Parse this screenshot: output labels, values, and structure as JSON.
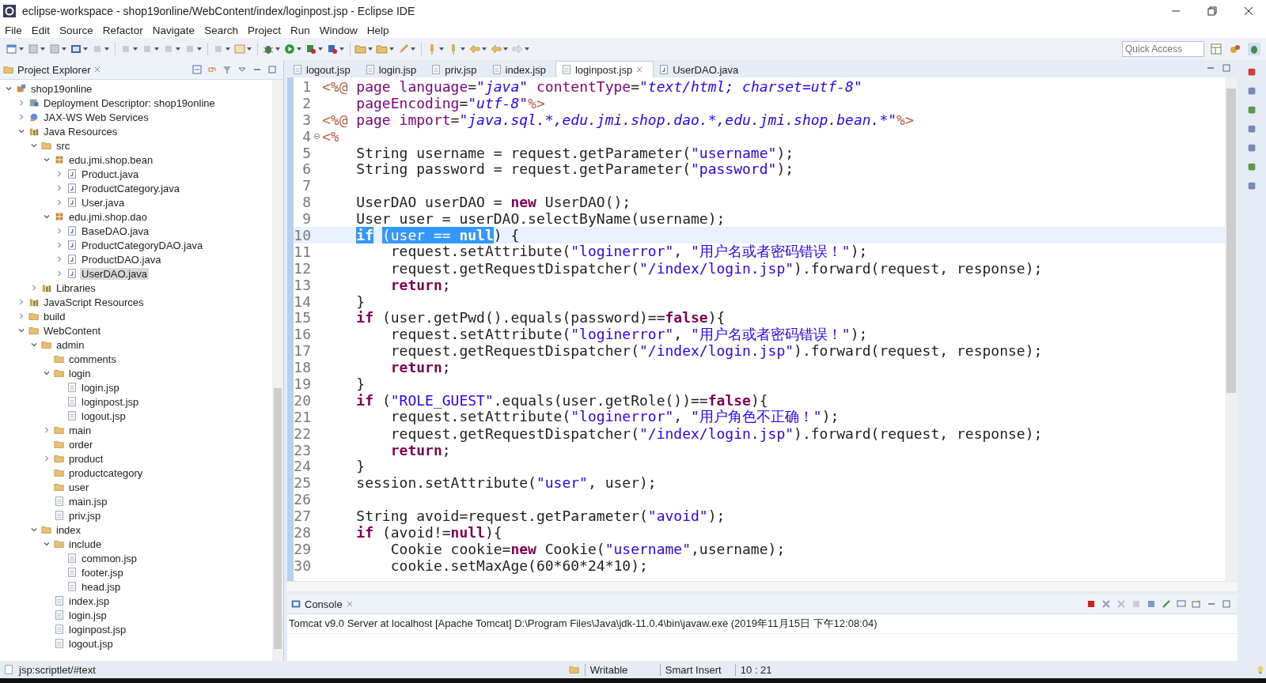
{
  "window": {
    "title": "eclipse-workspace - shop19online/WebContent/index/loginpost.jsp - Eclipse IDE"
  },
  "menu": [
    "File",
    "Edit",
    "Source",
    "Refactor",
    "Navigate",
    "Search",
    "Project",
    "Run",
    "Window",
    "Help"
  ],
  "quick_access": {
    "placeholder": "Quick Access"
  },
  "project_explorer": {
    "title": "Project Explorer",
    "tree": [
      {
        "label": "shop19online",
        "kind": "project",
        "expanded": true,
        "selected": false,
        "children": [
          {
            "label": "Deployment Descriptor: shop19online",
            "kind": "descriptor",
            "expanded": false,
            "selected": false
          },
          {
            "label": "JAX-WS Web Services",
            "kind": "services",
            "expanded": false,
            "selected": false
          },
          {
            "label": "Java Resources",
            "kind": "javares",
            "expanded": true,
            "selected": false,
            "children": [
              {
                "label": "src",
                "kind": "srcfolder",
                "expanded": true,
                "selected": false,
                "children": [
                  {
                    "label": "edu.jmi.shop.bean",
                    "kind": "package",
                    "expanded": true,
                    "selected": false,
                    "children": [
                      {
                        "label": "Product.java",
                        "kind": "java",
                        "expanded": false,
                        "selected": false
                      },
                      {
                        "label": "ProductCategory.java",
                        "kind": "java",
                        "expanded": false,
                        "selected": false
                      },
                      {
                        "label": "User.java",
                        "kind": "java",
                        "expanded": false,
                        "selected": false
                      }
                    ]
                  },
                  {
                    "label": "edu.jmi.shop.dao",
                    "kind": "package",
                    "expanded": true,
                    "selected": false,
                    "children": [
                      {
                        "label": "BaseDAO.java",
                        "kind": "java",
                        "expanded": false,
                        "selected": false
                      },
                      {
                        "label": "ProductCategoryDAO.java",
                        "kind": "java",
                        "expanded": false,
                        "selected": false
                      },
                      {
                        "label": "ProductDAO.java",
                        "kind": "java",
                        "expanded": false,
                        "selected": false
                      },
                      {
                        "label": "UserDAO.java",
                        "kind": "java",
                        "expanded": false,
                        "selected": true
                      }
                    ]
                  }
                ]
              },
              {
                "label": "Libraries",
                "kind": "library",
                "expanded": false,
                "selected": false
              }
            ]
          },
          {
            "label": "JavaScript Resources",
            "kind": "library",
            "expanded": false,
            "selected": false
          },
          {
            "label": "build",
            "kind": "folder",
            "expanded": false,
            "selected": false
          },
          {
            "label": "WebContent",
            "kind": "folder",
            "expanded": true,
            "selected": false,
            "children": [
              {
                "label": "admin",
                "kind": "folder",
                "expanded": true,
                "selected": false,
                "children": [
                  {
                    "label": "comments",
                    "kind": "folder",
                    "selected": false
                  },
                  {
                    "label": "login",
                    "kind": "folder",
                    "expanded": true,
                    "selected": false,
                    "children": [
                      {
                        "label": "login.jsp",
                        "kind": "jsp",
                        "selected": false
                      },
                      {
                        "label": "loginpost.jsp",
                        "kind": "jsp",
                        "selected": false
                      },
                      {
                        "label": "logout.jsp",
                        "kind": "jsp",
                        "selected": false
                      }
                    ]
                  },
                  {
                    "label": "main",
                    "kind": "folder",
                    "expanded": false,
                    "selected": false
                  },
                  {
                    "label": "order",
                    "kind": "folder",
                    "selected": false
                  },
                  {
                    "label": "product",
                    "kind": "folder",
                    "expanded": false,
                    "selected": false
                  },
                  {
                    "label": "productcategory",
                    "kind": "folder",
                    "selected": false
                  },
                  {
                    "label": "user",
                    "kind": "folder",
                    "selected": false
                  },
                  {
                    "label": "main.jsp",
                    "kind": "jsp",
                    "selected": false
                  },
                  {
                    "label": "priv.jsp",
                    "kind": "jsp",
                    "selected": false
                  }
                ]
              },
              {
                "label": "index",
                "kind": "folder",
                "expanded": true,
                "selected": false,
                "children": [
                  {
                    "label": "include",
                    "kind": "folder",
                    "expanded": true,
                    "selected": false,
                    "children": [
                      {
                        "label": "common.jsp",
                        "kind": "jsp",
                        "selected": false
                      },
                      {
                        "label": "footer.jsp",
                        "kind": "jsp",
                        "selected": false
                      },
                      {
                        "label": "head.jsp",
                        "kind": "jsp",
                        "selected": false
                      }
                    ]
                  },
                  {
                    "label": "index.jsp",
                    "kind": "jsp",
                    "selected": false
                  },
                  {
                    "label": "login.jsp",
                    "kind": "jsp",
                    "selected": false
                  },
                  {
                    "label": "loginpost.jsp",
                    "kind": "jsp",
                    "selected": false
                  },
                  {
                    "label": "logout.jsp",
                    "kind": "jsp",
                    "selected": false
                  }
                ]
              }
            ]
          }
        ]
      }
    ]
  },
  "editor": {
    "tabs": [
      {
        "label": "logout.jsp",
        "kind": "jsp",
        "selected": false
      },
      {
        "label": "login.jsp",
        "kind": "jsp",
        "selected": false
      },
      {
        "label": "priv.jsp",
        "kind": "jsp",
        "selected": false
      },
      {
        "label": "index.jsp",
        "kind": "jsp",
        "selected": false
      },
      {
        "label": "loginpost.jsp",
        "kind": "jsp",
        "selected": true
      },
      {
        "label": "UserDAO.java",
        "kind": "java",
        "selected": false
      }
    ],
    "lines": [
      {
        "number": "1",
        "fold": false,
        "current": false,
        "tokens": [
          {
            "kind": "tag",
            "text": "<%@"
          },
          {
            "kind": "attr",
            "text": " page language"
          },
          {
            "kind": "text",
            "text": "="
          },
          {
            "kind": "value",
            "text": "\"java\""
          },
          {
            "kind": "attr",
            "text": " contentType"
          },
          {
            "kind": "text",
            "text": "="
          },
          {
            "kind": "value",
            "text": "\"text/html; charset=utf-8\""
          }
        ]
      },
      {
        "number": "2",
        "fold": false,
        "current": false,
        "tokens": [
          {
            "kind": "attr",
            "text": "    pageEncoding"
          },
          {
            "kind": "text",
            "text": "="
          },
          {
            "kind": "value",
            "text": "\"utf-8\""
          },
          {
            "kind": "tag",
            "text": "%>"
          }
        ]
      },
      {
        "number": "3",
        "fold": false,
        "current": false,
        "tokens": [
          {
            "kind": "tag",
            "text": "<%@"
          },
          {
            "kind": "attr",
            "text": " page import"
          },
          {
            "kind": "text",
            "text": "="
          },
          {
            "kind": "value",
            "text": "\"java.sql.*,edu.jmi.shop.dao.*,edu.jmi.shop.bean.*\""
          },
          {
            "kind": "tag",
            "text": "%>"
          }
        ]
      },
      {
        "number": "4",
        "fold": true,
        "current": false,
        "tokens": [
          {
            "kind": "tag",
            "text": "<%"
          }
        ]
      },
      {
        "number": "5",
        "fold": false,
        "current": false,
        "tokens": [
          {
            "kind": "text",
            "text": "    String username = request.getParameter("
          },
          {
            "kind": "string",
            "text": "\"username\""
          },
          {
            "kind": "text",
            "text": ");"
          }
        ]
      },
      {
        "number": "6",
        "fold": false,
        "current": false,
        "tokens": [
          {
            "kind": "text",
            "text": "    String password = request.getParameter("
          },
          {
            "kind": "string",
            "text": "\"password\""
          },
          {
            "kind": "text",
            "text": ");"
          }
        ]
      },
      {
        "number": "7",
        "fold": false,
        "current": false
      },
      {
        "number": "8",
        "fold": false,
        "current": false,
        "tokens": [
          {
            "kind": "text",
            "text": "    UserDAO userDAO = "
          },
          {
            "kind": "keyword",
            "text": "new"
          },
          {
            "kind": "text",
            "text": " UserDAO();"
          }
        ]
      },
      {
        "number": "9",
        "fold": false,
        "current": false,
        "tokens": [
          {
            "kind": "text",
            "text": "    User user = userDAO.selectByName(username);"
          }
        ]
      },
      {
        "number": "10",
        "fold": false,
        "current": true,
        "tokens": [
          {
            "kind": "keyword",
            "text": "    if",
            "selected": true
          },
          {
            "kind": "text",
            "text": " (user == ",
            "selected": true
          },
          {
            "kind": "keyword",
            "text": "null",
            "selected": true
          },
          {
            "kind": "text",
            "text": ") {",
            "selected": false
          }
        ]
      },
      {
        "number": "11",
        "fold": false,
        "current": false,
        "tokens": [
          {
            "kind": "text",
            "text": "        request.setAttribute("
          },
          {
            "kind": "string",
            "text": "\"loginerror\""
          },
          {
            "kind": "text",
            "text": ", "
          },
          {
            "kind": "string",
            "text": "\"用户名或者密码错误！\""
          },
          {
            "kind": "text",
            "text": ");"
          }
        ]
      },
      {
        "number": "12",
        "fold": false,
        "current": false,
        "tokens": [
          {
            "kind": "text",
            "text": "        request.getRequestDispatcher("
          },
          {
            "kind": "string",
            "text": "\"/index/login.jsp\""
          },
          {
            "kind": "text",
            "text": ").forward(request, response);"
          }
        ]
      },
      {
        "number": "13",
        "fold": false,
        "current": false,
        "tokens": [
          {
            "kind": "keyword",
            "text": "        return"
          },
          {
            "kind": "text",
            "text": ";"
          }
        ]
      },
      {
        "number": "14",
        "fold": false,
        "current": false,
        "tokens": [
          {
            "kind": "text",
            "text": "    }"
          }
        ]
      },
      {
        "number": "15",
        "fold": false,
        "current": false,
        "tokens": [
          {
            "kind": "keyword",
            "text": "    if"
          },
          {
            "kind": "text",
            "text": " (user.getPwd().equals(password)=="
          },
          {
            "kind": "keyword",
            "text": "false"
          },
          {
            "kind": "text",
            "text": "){"
          }
        ]
      },
      {
        "number": "16",
        "fold": false,
        "current": false,
        "tokens": [
          {
            "kind": "text",
            "text": "        request.setAttribute("
          },
          {
            "kind": "string",
            "text": "\"loginerror\""
          },
          {
            "kind": "text",
            "text": ", "
          },
          {
            "kind": "string",
            "text": "\"用户名或者密码错误！\""
          },
          {
            "kind": "text",
            "text": ");"
          }
        ]
      },
      {
        "number": "17",
        "fold": false,
        "current": false,
        "tokens": [
          {
            "kind": "text",
            "text": "        request.getRequestDispatcher("
          },
          {
            "kind": "string",
            "text": "\"/index/login.jsp\""
          },
          {
            "kind": "text",
            "text": ").forward(request, response);"
          }
        ]
      },
      {
        "number": "18",
        "fold": false,
        "current": false,
        "tokens": [
          {
            "kind": "keyword",
            "text": "        return"
          },
          {
            "kind": "text",
            "text": ";"
          }
        ]
      },
      {
        "number": "19",
        "fold": false,
        "current": false,
        "tokens": [
          {
            "kind": "text",
            "text": "    }"
          }
        ]
      },
      {
        "number": "20",
        "fold": false,
        "current": false,
        "tokens": [
          {
            "kind": "keyword",
            "text": "    if"
          },
          {
            "kind": "text",
            "text": " ("
          },
          {
            "kind": "string",
            "text": "\"ROLE_GUEST\""
          },
          {
            "kind": "text",
            "text": ".equals(user.getRole())=="
          },
          {
            "kind": "keyword",
            "text": "false"
          },
          {
            "kind": "text",
            "text": "){"
          }
        ]
      },
      {
        "number": "21",
        "fold": false,
        "current": false,
        "tokens": [
          {
            "kind": "text",
            "text": "        request.setAttribute("
          },
          {
            "kind": "string",
            "text": "\"loginerror\""
          },
          {
            "kind": "text",
            "text": ", "
          },
          {
            "kind": "string",
            "text": "\"用户角色不正确！\""
          },
          {
            "kind": "text",
            "text": ");"
          }
        ]
      },
      {
        "number": "22",
        "fold": false,
        "current": false,
        "tokens": [
          {
            "kind": "text",
            "text": "        request.getRequestDispatcher("
          },
          {
            "kind": "string",
            "text": "\"/index/login.jsp\""
          },
          {
            "kind": "text",
            "text": ").forward(request, response);"
          }
        ]
      },
      {
        "number": "23",
        "fold": false,
        "current": false,
        "tokens": [
          {
            "kind": "keyword",
            "text": "        return"
          },
          {
            "kind": "text",
            "text": ";"
          }
        ]
      },
      {
        "number": "24",
        "fold": false,
        "current": false,
        "tokens": [
          {
            "kind": "text",
            "text": "    }"
          }
        ]
      },
      {
        "number": "25",
        "fold": false,
        "current": false,
        "tokens": [
          {
            "kind": "text",
            "text": "    session.setAttribute("
          },
          {
            "kind": "string",
            "text": "\"user\""
          },
          {
            "kind": "text",
            "text": ", user);"
          }
        ]
      },
      {
        "number": "26",
        "fold": false,
        "current": false
      },
      {
        "number": "27",
        "fold": false,
        "current": false,
        "tokens": [
          {
            "kind": "text",
            "text": "    String avoid=request.getParameter("
          },
          {
            "kind": "string",
            "text": "\"avoid\""
          },
          {
            "kind": "text",
            "text": ");"
          }
        ]
      },
      {
        "number": "28",
        "fold": false,
        "current": false,
        "tokens": [
          {
            "kind": "keyword",
            "text": "    if"
          },
          {
            "kind": "text",
            "text": " (avoid!="
          },
          {
            "kind": "keyword",
            "text": "null"
          },
          {
            "kind": "text",
            "text": "){"
          }
        ]
      },
      {
        "number": "29",
        "fold": false,
        "current": false,
        "tokens": [
          {
            "kind": "text",
            "text": "        Cookie cookie="
          },
          {
            "kind": "keyword",
            "text": "new"
          },
          {
            "kind": "text",
            "text": " Cookie("
          },
          {
            "kind": "string",
            "text": "\"username\""
          },
          {
            "kind": "text",
            "text": ",username);"
          }
        ]
      },
      {
        "number": "30",
        "fold": false,
        "current": false,
        "tokens": [
          {
            "kind": "text",
            "text": "        cookie.setMaxAge(60*60*24*10);"
          }
        ]
      }
    ]
  },
  "console": {
    "title": "Console",
    "text": "Tomcat v9.0 Server at localhost [Apache Tomcat] D:\\Program Files\\Java\\jdk-11.0.4\\bin\\javaw.exe (2019年11月15日 下午12:08:04)"
  },
  "status_bar": {
    "path": "jsp:scriptlet/#text",
    "mode": "Writable",
    "insert": "Smart Insert",
    "position": "10 : 21"
  }
}
